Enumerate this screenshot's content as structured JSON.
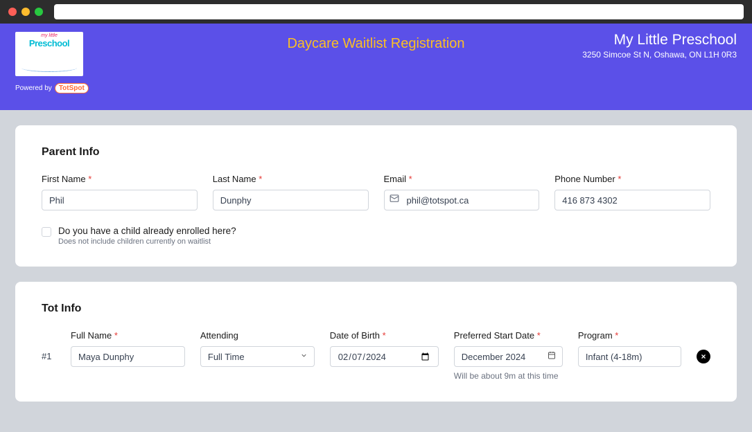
{
  "header": {
    "title": "Daycare Waitlist Registration",
    "org_name": "My Little Preschool",
    "org_address": "3250 Simcoe St N, Oshawa, ON L1H 0R3",
    "logo_top": "my little",
    "logo_main": "Preschool",
    "powered_by": "Powered by",
    "totspot_badge": "TotSpot"
  },
  "parent_section": {
    "title": "Parent Info",
    "first_name_label": "First Name",
    "first_name_value": "Phil",
    "last_name_label": "Last Name",
    "last_name_value": "Dunphy",
    "email_label": "Email",
    "email_value": "phil@totspot.ca",
    "phone_label": "Phone Number",
    "phone_value": "416 873 4302",
    "enrolled_label": "Do you have a child already enrolled here?",
    "enrolled_hint": "Does not include children currently on waitlist"
  },
  "tot_section": {
    "title": "Tot Info",
    "index_label": "#1",
    "full_name_label": "Full Name",
    "full_name_value": "Maya Dunphy",
    "attending_label": "Attending",
    "attending_value": "Full Time",
    "dob_label": "Date of Birth",
    "dob_value": "2024-02-07",
    "start_label": "Preferred Start Date",
    "start_value": "December 2024",
    "start_hint": "Will be about 9m at this time",
    "program_label": "Program",
    "program_value": "Infant (4-18m)",
    "required_marker": "*"
  }
}
